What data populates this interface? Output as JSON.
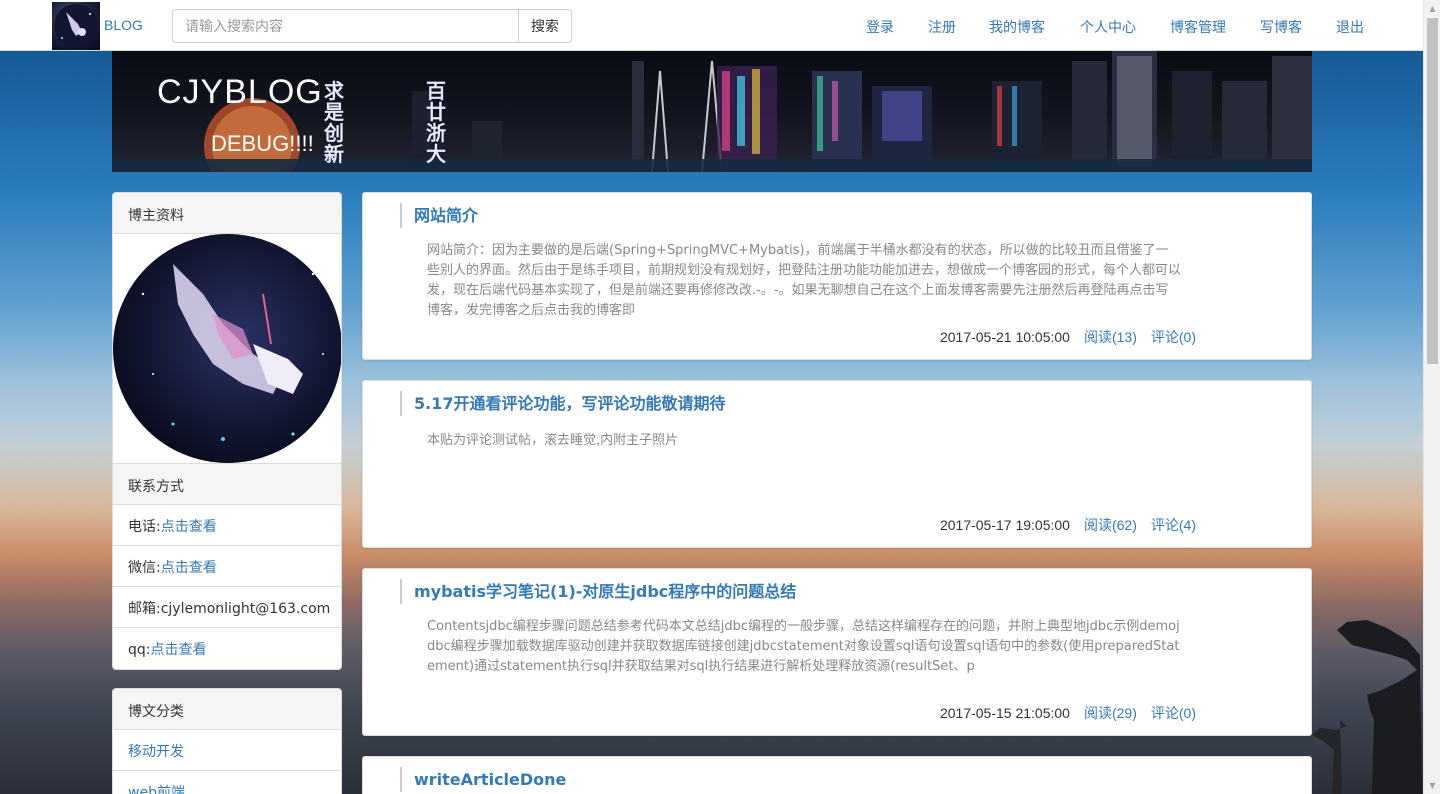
{
  "navbar": {
    "brand": "BLOG",
    "search_placeholder": "请输入搜索内容",
    "search_button": "搜索",
    "links": [
      "登录",
      "注册",
      "我的博客",
      "个人中心",
      "博客管理",
      "写博客",
      "退出"
    ]
  },
  "banner": {
    "title": "CJYBLOG",
    "subtitle": "DEBUG!!!!",
    "vertical_text_1": "求是创新",
    "vertical_text_2": "百廿浙大"
  },
  "sidebar": {
    "profile_heading": "博主资料",
    "contact_heading": "联系方式",
    "contacts": [
      {
        "label": "电话:",
        "value": "点击查看",
        "link": true
      },
      {
        "label": "微信:",
        "value": "点击查看",
        "link": true
      },
      {
        "label": "邮箱:",
        "value": "cjylemonlight@163.com",
        "link": false
      },
      {
        "label": "qq:",
        "value": "点击查看",
        "link": true
      }
    ],
    "category_heading": "博文分类",
    "categories": [
      "移动开发",
      "web前端"
    ]
  },
  "posts": [
    {
      "title": "网站简介",
      "summary": "网站简介：因为主要做的是后端(Spring+SpringMVC+Mybatis)，前端属于半桶水都没有的状态，所以做的比较丑而且借鉴了一些别人的界面。然后由于是练手项目，前期规划没有规划好，把登陆注册功能功能加进去，想做成一个博客园的形式，每个人都可以发，现在后端代码基本实现了，但是前端还要再修修改改.-。-。如果无聊想自己在这个上面发博客需要先注册然后再登陆再点击写博客，发完博客之后点击我的博客即",
      "date": "2017-05-21 10:05:00",
      "reads": "阅读(13)",
      "comments": "评论(0)"
    },
    {
      "title": "5.17开通看评论功能，写评论功能敬请期待",
      "summary": "本贴为评论测试帖，滚去睡觉,内附主子照片",
      "date": "2017-05-17 19:05:00",
      "reads": "阅读(62)",
      "comments": "评论(4)"
    },
    {
      "title": "mybatis学习笔记(1)-对原生jdbc程序中的问题总结",
      "summary": "Contentsjdbc编程步骤问题总结参考代码本文总结jdbc编程的一般步骤，总结这样编程存在的问题，并附上典型地jdbc示例demojdbc编程步骤加载数据库驱动创建并获取数据库链接创建jdbcstatement对象设置sql语句设置sql语句中的参数(使用preparedStatement)通过statement执行sql并获取结果对sql执行结果进行解析处理释放资源(resultSet、p",
      "date": "2017-05-15 21:05:00",
      "reads": "阅读(29)",
      "comments": "评论(0)"
    },
    {
      "title": "writeArticleDone",
      "summary": "",
      "date": "",
      "reads": "",
      "comments": ""
    }
  ]
}
